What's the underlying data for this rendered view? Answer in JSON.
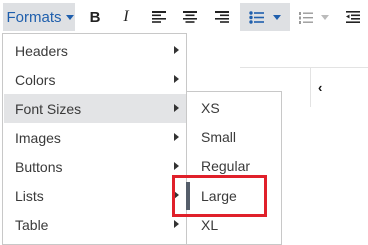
{
  "toolbar": {
    "formats_label": "Formats",
    "bold_label": "B",
    "italic_label": "I",
    "icons": [
      "align-left-icon",
      "align-center-icon",
      "align-right-icon",
      "bullet-list-icon",
      "numbered-list-icon",
      "outdent-icon"
    ]
  },
  "menu": {
    "items": [
      {
        "label": "Headers"
      },
      {
        "label": "Colors"
      },
      {
        "label": "Font Sizes"
      },
      {
        "label": "Images"
      },
      {
        "label": "Buttons"
      },
      {
        "label": "Lists"
      },
      {
        "label": "Table"
      }
    ],
    "active_item": "Font Sizes"
  },
  "submenu": {
    "items": [
      {
        "label": "XS"
      },
      {
        "label": "Small"
      },
      {
        "label": "Regular"
      },
      {
        "label": "Large"
      },
      {
        "label": "XL"
      }
    ],
    "selected": "Large"
  },
  "colors": {
    "accent": "#1f5fad",
    "highlight": "#e0202a",
    "active_bg": "#e3e4e6"
  },
  "editor": {
    "glyph": "‹"
  }
}
